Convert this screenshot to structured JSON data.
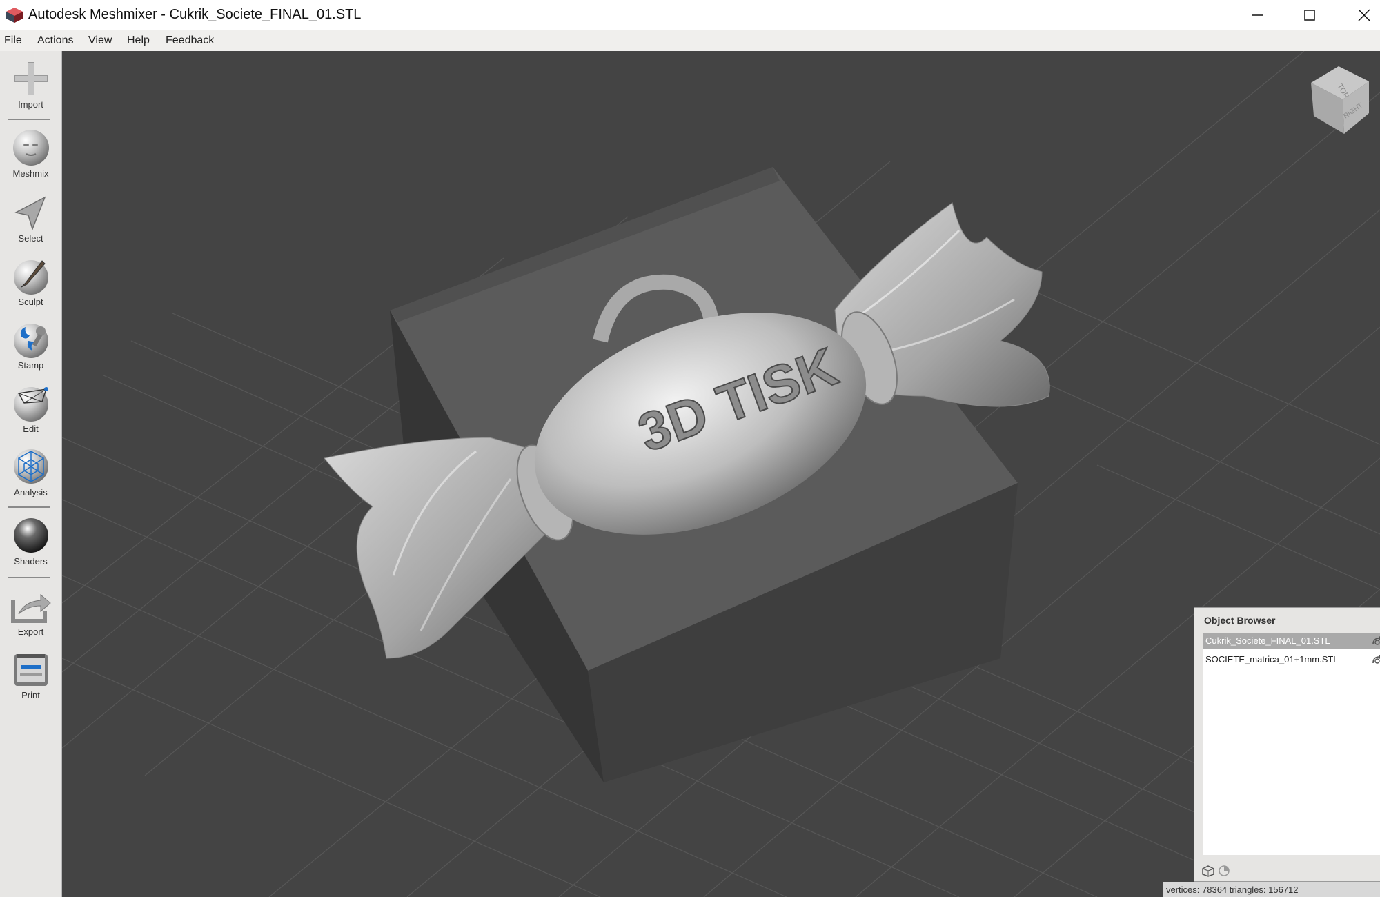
{
  "window": {
    "title": "Autodesk Meshmixer - Cukrik_Societe_FINAL_01.STL"
  },
  "menu": [
    "File",
    "Actions",
    "View",
    "Help",
    "Feedback"
  ],
  "tools": [
    {
      "label": "Import",
      "icon": "plus-icon"
    },
    {
      "label": "Meshmix",
      "icon": "face-ball-icon"
    },
    {
      "label": "Select",
      "icon": "arrow-cursor-icon"
    },
    {
      "label": "Sculpt",
      "icon": "brush-ball-icon"
    },
    {
      "label": "Stamp",
      "icon": "stamp-ball-icon"
    },
    {
      "label": "Edit",
      "icon": "edit-ball-icon"
    },
    {
      "label": "Analysis",
      "icon": "analysis-ball-icon"
    },
    {
      "label": "Shaders",
      "icon": "shader-ball-icon"
    },
    {
      "label": "Export",
      "icon": "export-icon"
    },
    {
      "label": "Print",
      "icon": "printer-icon"
    }
  ],
  "viewport": {
    "embossed_text": "3D TISK",
    "view_cube": {
      "top": "TOP",
      "right": "RIGHT"
    }
  },
  "object_browser": {
    "title": "Object Browser",
    "items": [
      {
        "name": "Cukrik_Societe_FINAL_01.STL",
        "selected": true
      },
      {
        "name": "SOCIETE_matrica_01+1mm.STL",
        "selected": false
      }
    ]
  },
  "status": "vertices: 78364 triangles: 156712"
}
